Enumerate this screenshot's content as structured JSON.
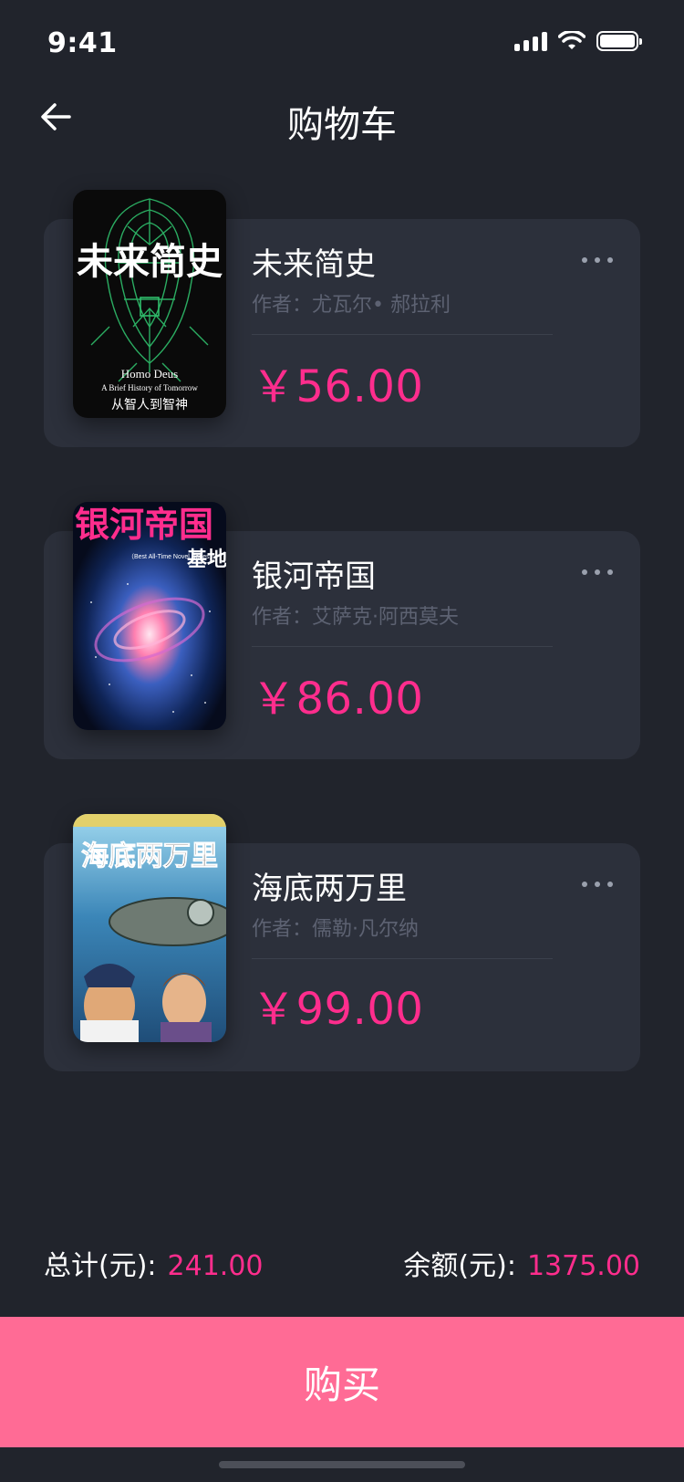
{
  "status_bar": {
    "time": "9:41"
  },
  "nav": {
    "title": "购物车"
  },
  "books": [
    {
      "title": "未来简史",
      "author": "作者：尤瓦尔• 郝拉利",
      "price": "￥56.00",
      "cover": {
        "main_text": "未来简史",
        "english_line1": "Homo Deus",
        "english_line2": "A Brief History of Tomorrow",
        "sub_text": "从智人到智神"
      }
    },
    {
      "title": "银河帝国",
      "author": "作者：艾萨克·阿西莫夫",
      "price": "￥86.00",
      "cover": {
        "main_text": "银河帝国",
        "sub_text": "基地",
        "english_line1": "（Best All-Time Novel Series）"
      }
    },
    {
      "title": "海底两万里",
      "author": "作者：儒勒·凡尔纳",
      "price": "￥99.00",
      "cover": {
        "main_text": "海底两万里"
      }
    }
  ],
  "summary": {
    "total_label": "总计(元):",
    "total_value": "241.00",
    "balance_label": "余额(元):",
    "balance_value": "1375.00"
  },
  "buy_button": {
    "label": "购买"
  },
  "colors": {
    "background": "#21242c",
    "card": "#2c303b",
    "accent": "#ff2d8d",
    "buy_button": "#ff6b95"
  }
}
